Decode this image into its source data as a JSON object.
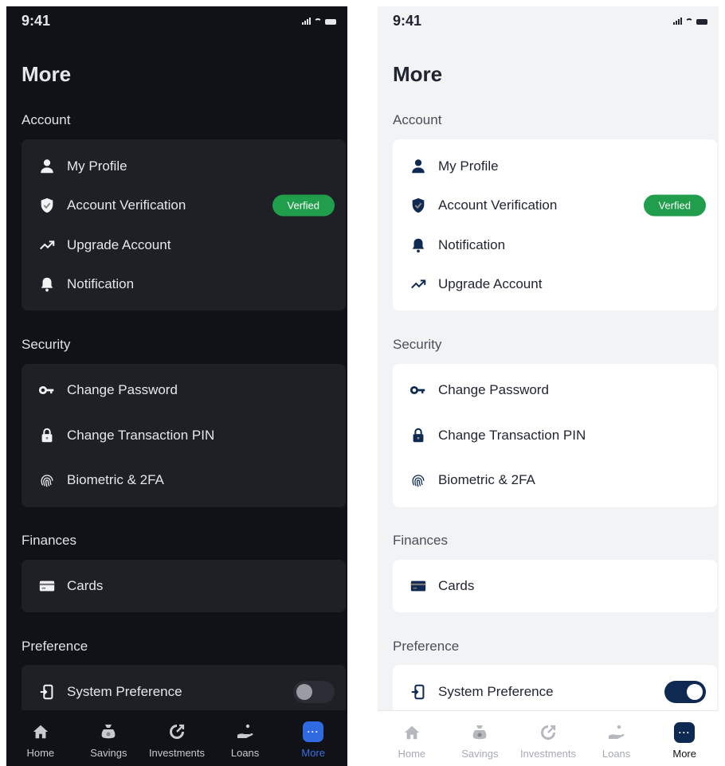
{
  "status": {
    "time": "9:41"
  },
  "title": "More",
  "sections": {
    "account": "Account",
    "security": "Security",
    "finances": "Finances",
    "preference": "Preference"
  },
  "items": {
    "my_profile": "My Profile",
    "account_verification": "Account Verification",
    "verified_badge": "Verfied",
    "upgrade_account": "Upgrade Account",
    "notification": "Notification",
    "change_password": "Change Password",
    "change_pin": "Change Transaction PIN",
    "biometric": "Biometric & 2FA",
    "cards": "Cards",
    "system_preference": "System Preference"
  },
  "system_preference_toggle": {
    "dark": false,
    "light": true
  },
  "tabs": {
    "home": "Home",
    "savings": "Savings",
    "investments": "Investments",
    "loans": "Loans",
    "more": "More"
  },
  "colors": {
    "accent_dark": "#2f6ae0",
    "accent_light": "#0e2a52",
    "verified": "#219e4c"
  }
}
